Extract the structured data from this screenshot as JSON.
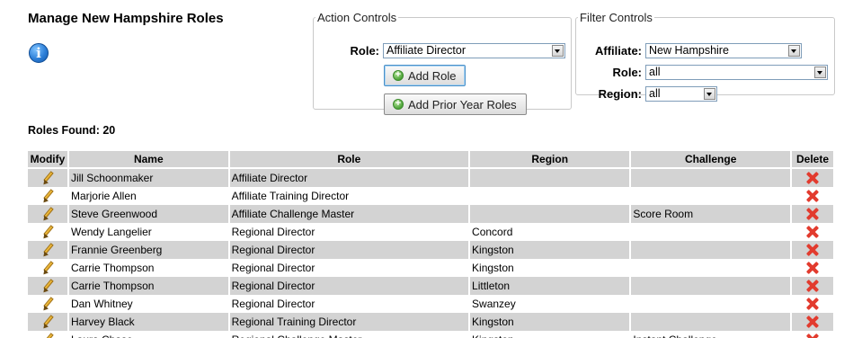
{
  "page": {
    "title": "Manage New Hampshire Roles",
    "roles_found_label": "Roles Found:",
    "roles_found_count": "20"
  },
  "action_controls": {
    "legend": "Action Controls",
    "role_label": "Role:",
    "role_value": "Affiliate Director",
    "add_role_label": "Add Role",
    "add_prior_label": "Add Prior Year Roles"
  },
  "filter_controls": {
    "legend": "Filter Controls",
    "affiliate_label": "Affiliate:",
    "affiliate_value": "New Hampshire",
    "role_label": "Role:",
    "role_value": "all",
    "region_label": "Region:",
    "region_value": "all"
  },
  "table": {
    "headers": [
      "Modify",
      "Name",
      "Role",
      "Region",
      "Challenge",
      "Delete"
    ],
    "rows": [
      {
        "name": "Jill Schoonmaker",
        "role": "Affiliate Director",
        "region": "",
        "challenge": ""
      },
      {
        "name": "Marjorie Allen",
        "role": "Affiliate Training Director",
        "region": "",
        "challenge": ""
      },
      {
        "name": "Steve Greenwood",
        "role": "Affiliate Challenge Master",
        "region": "",
        "challenge": "Score Room"
      },
      {
        "name": "Wendy Langelier",
        "role": "Regional Director",
        "region": "Concord",
        "challenge": ""
      },
      {
        "name": "Frannie Greenberg",
        "role": "Regional Director",
        "region": "Kingston",
        "challenge": ""
      },
      {
        "name": "Carrie Thompson",
        "role": "Regional Director",
        "region": "Kingston",
        "challenge": ""
      },
      {
        "name": "Carrie Thompson",
        "role": "Regional Director",
        "region": "Littleton",
        "challenge": ""
      },
      {
        "name": "Dan Whitney",
        "role": "Regional Director",
        "region": "Swanzey",
        "challenge": ""
      },
      {
        "name": "Harvey Black",
        "role": "Regional Training Director",
        "region": "Kingston",
        "challenge": ""
      },
      {
        "name": "Laura Chase",
        "role": "Regional Challenge Master",
        "region": "Kingston",
        "challenge": "Instant Challenge"
      }
    ]
  },
  "icons": {
    "info": "info-icon",
    "modify": "pencil-icon",
    "delete": "delete-icon",
    "add": "plus-icon",
    "dropdown": "chevron-down-icon"
  },
  "colors": {
    "row_alt": "#d3d3d3",
    "header_bg": "#d3d3d3",
    "delete_red": "#e23b2e",
    "info_blue": "#2d7fd8"
  }
}
